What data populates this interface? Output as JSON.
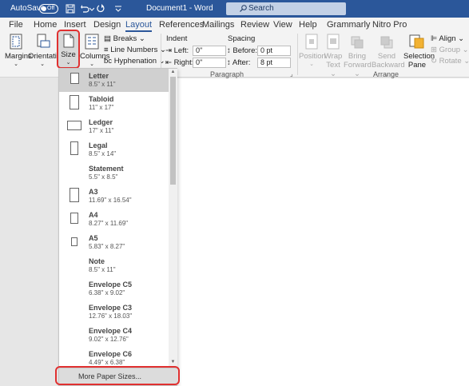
{
  "titlebar": {
    "autosave_label": "AutoSave",
    "autosave_state": "Off",
    "doc_title": "Document1 - Word",
    "search_placeholder": "Search"
  },
  "tabs": [
    "File",
    "Home",
    "Insert",
    "Design",
    "Layout",
    "References",
    "Mailings",
    "Review",
    "View",
    "Help",
    "Grammarly",
    "Nitro Pro"
  ],
  "active_tab": "Layout",
  "ribbon": {
    "margins": "Margins",
    "orientation": "Orientation",
    "size": "Size",
    "columns": "Columns",
    "breaks": "Breaks",
    "line_numbers": "Line Numbers",
    "hyphenation": "Hyphenation",
    "indent_label": "Indent",
    "spacing_label": "Spacing",
    "left_label": "Left:",
    "left_value": "0\"",
    "right_label": "Right:",
    "right_value": "0\"",
    "before_label": "Before:",
    "before_value": "0 pt",
    "after_label": "After:",
    "after_value": "8 pt",
    "paragraph_group": "Paragraph",
    "position": "Position",
    "wrap_text_1": "Wrap",
    "wrap_text_2": "Text",
    "bring_forward_1": "Bring",
    "bring_forward_2": "Forward",
    "send_backward_1": "Send",
    "send_backward_2": "Backward",
    "selection_pane_1": "Selection",
    "selection_pane_2": "Pane",
    "align": "Align",
    "group": "Group",
    "rotate": "Rotate",
    "arrange_group": "Arrange"
  },
  "size_menu": {
    "items": [
      {
        "name": "Letter",
        "dims": "8.5\" x 11\""
      },
      {
        "name": "Tabloid",
        "dims": "11\" x 17\""
      },
      {
        "name": "Ledger",
        "dims": "17\" x 11\""
      },
      {
        "name": "Legal",
        "dims": "8.5\" x 14\""
      },
      {
        "name": "Statement",
        "dims": "5.5\" x 8.5\""
      },
      {
        "name": "A3",
        "dims": "11.69\" x 16.54\""
      },
      {
        "name": "A4",
        "dims": "8.27\" x 11.69\""
      },
      {
        "name": "A5",
        "dims": "5.83\" x 8.27\""
      },
      {
        "name": "Note",
        "dims": "8.5\" x 11\""
      },
      {
        "name": "Envelope C5",
        "dims": "6.38\" x 9.02\""
      },
      {
        "name": "Envelope C3",
        "dims": "12.76\" x 18.03\""
      },
      {
        "name": "Envelope C4",
        "dims": "9.02\" x 12.76\""
      },
      {
        "name": "Envelope C6",
        "dims": "4.49\" x 6.38\""
      }
    ],
    "more_label": "More Paper Sizes..."
  },
  "colors": {
    "accent": "#2b579a",
    "highlight": "#e03030"
  }
}
